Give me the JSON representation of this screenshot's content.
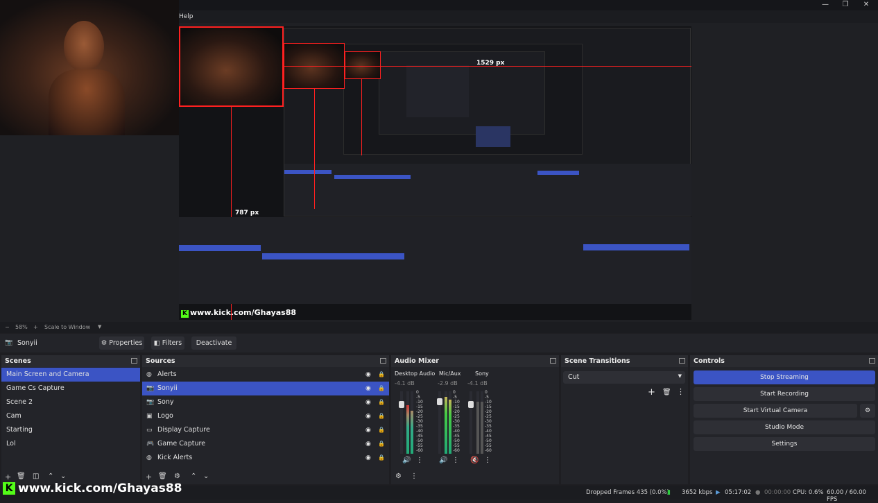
{
  "menu": {
    "help_label": "Help"
  },
  "preview": {
    "measure_h": "1529 px",
    "measure_v": "787 px",
    "watermark": "www.kick.com/Ghayas88"
  },
  "zoom": {
    "minus": "−",
    "value": "58%",
    "plus": "+",
    "mode": "Scale to Window"
  },
  "context": {
    "source_name": "Sonyii",
    "properties_label": "Properties",
    "filters_label": "Filters",
    "deactivate_label": "Deactivate"
  },
  "scenes": {
    "title": "Scenes",
    "items": [
      "Main Screen and Camera",
      "Game Cs Capture",
      "Scene 2",
      "Cam",
      "Starting",
      "Lol"
    ],
    "selected": 0
  },
  "sources": {
    "title": "Sources",
    "items": [
      {
        "label": "Alerts",
        "icon": "browser-icon"
      },
      {
        "label": "Sonyii",
        "icon": "camera-icon"
      },
      {
        "label": "Sony",
        "icon": "camera-icon"
      },
      {
        "label": "Logo",
        "icon": "image-icon"
      },
      {
        "label": "Display Capture",
        "icon": "monitor-icon"
      },
      {
        "label": "Game Capture",
        "icon": "gamepad-icon"
      },
      {
        "label": "Kick Alerts",
        "icon": "browser-icon"
      }
    ],
    "selected": 1
  },
  "audio": {
    "title": "Audio Mixer",
    "channels": [
      {
        "name": "Desktop Audio",
        "db": "-4.1 dB"
      },
      {
        "name": "Mic/Aux",
        "db": "-2.9 dB"
      },
      {
        "name": "Sony",
        "db": "-4.1 dB"
      }
    ],
    "scale": [
      "0",
      "-5",
      "-10",
      "-15",
      "-20",
      "-25",
      "-30",
      "-35",
      "-40",
      "-45",
      "-50",
      "-55",
      "-60"
    ]
  },
  "transitions": {
    "title": "Scene Transitions",
    "selected": "Cut"
  },
  "controls": {
    "title": "Controls",
    "stop_streaming": "Stop Streaming",
    "start_recording": "Start Recording",
    "start_virtual_camera": "Start Virtual Camera",
    "studio_mode": "Studio Mode",
    "settings": "Settings"
  },
  "status": {
    "dropped_frames": "Dropped Frames 435 (0.0%)",
    "bitrate": "3652 kbps",
    "stream_time": "05:17:02",
    "rec_time": "00:00:00",
    "cpu": "CPU: 0.6%",
    "fps": "60.00 / 60.00 FPS"
  },
  "colors": {
    "accent": "#3b54c4",
    "kick_green": "#53fc18",
    "measure_red": "#ff2020"
  }
}
